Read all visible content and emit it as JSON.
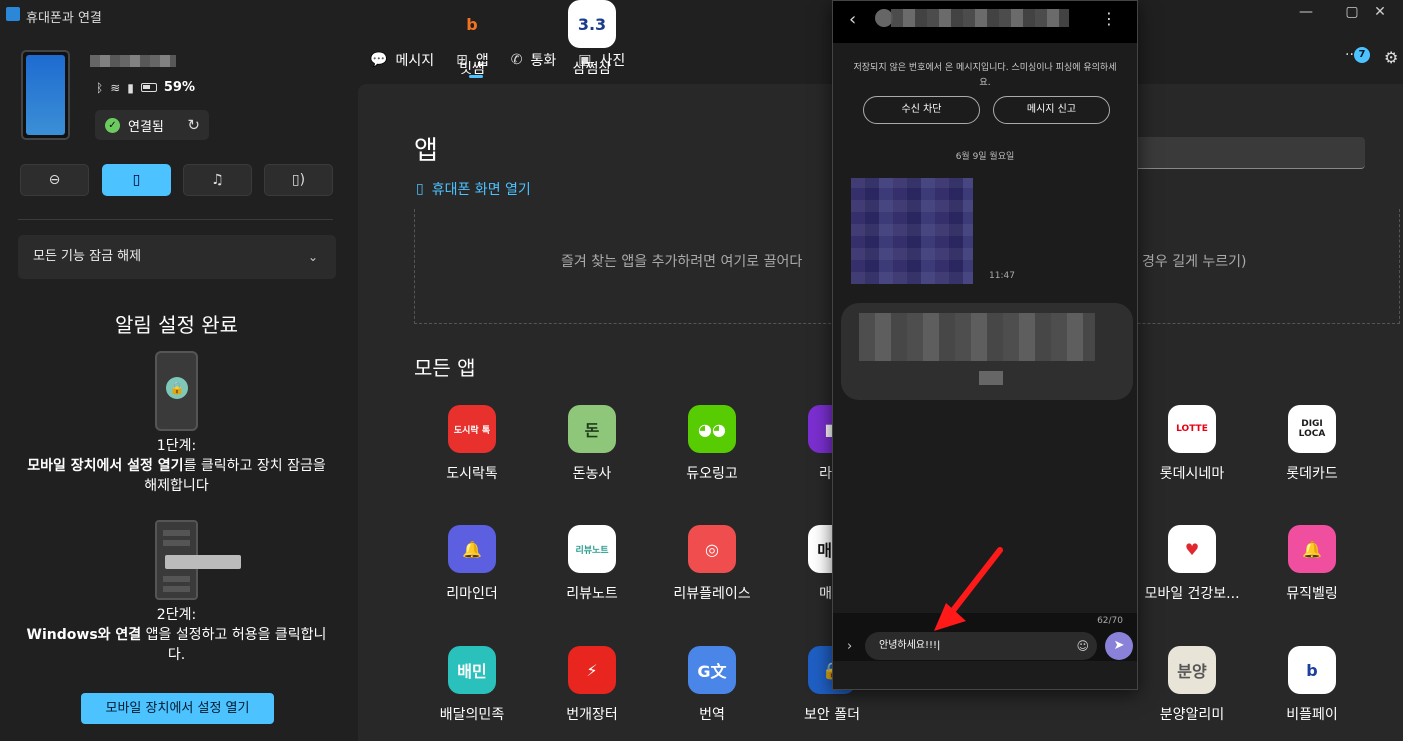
{
  "window": {
    "title": "휴대폰과 연결",
    "controls": [
      "—",
      "▢",
      "✕"
    ]
  },
  "device": {
    "battery": "59%",
    "connection_status": "연결됨"
  },
  "quick_actions": [
    "focus",
    "vibrate",
    "music",
    "audio-output"
  ],
  "unlock_all": "모든 기능 잠금 해제",
  "setup": {
    "title": "알림 설정 완료",
    "step1_heading": "1단계:",
    "step1_text_bold": "모바일 장치에서 설정 열기",
    "step1_text_rest": "를 클릭하고 장치 잠금을 해제합니다",
    "step2_heading": "2단계:",
    "step2_text_bold": "Windows와 연결",
    "step2_text_rest": " 앱을 설정하고 허용을 클릭합니다.",
    "button": "모바일 장치에서 설정 열기"
  },
  "nav": {
    "tabs": [
      {
        "label": "메시지",
        "icon": "chat-icon"
      },
      {
        "label": "앱",
        "icon": "apps-grid-icon",
        "active": true
      },
      {
        "label": "통화",
        "icon": "phone-icon"
      },
      {
        "label": "사진",
        "icon": "photo-icon"
      }
    ],
    "notification_count": "7"
  },
  "apps_page": {
    "title": "앱",
    "open_phone_screen": "휴대폰 화면 열기",
    "favorites_hint_left": "즐겨 찾는 앱을 추가하려면 여기로 끌어다",
    "favorites_hint_right": "경우 길게 누르기)",
    "all_apps_title": "모든 앱"
  },
  "apps": [
    {
      "label": "도시락톡",
      "glyph": "도시락\n톡",
      "bg": "#e8302c",
      "fg": "#fff"
    },
    {
      "label": "돈농사",
      "glyph": "돈",
      "bg": "#8fc77a",
      "fg": "#1f3d1a"
    },
    {
      "label": "듀오링고",
      "glyph": "◕◕",
      "bg": "#58cc02",
      "fg": "#fff"
    },
    {
      "label": "라디",
      "glyph": "■",
      "bg": "#7b2fd0",
      "fg": "#fff"
    },
    {
      "label": "롯데시네마",
      "glyph": "LOTTE",
      "bg": "#ffffff",
      "fg": "#e60012"
    },
    {
      "label": "롯데카드",
      "glyph": "DIGI LOCA",
      "bg": "#ffffff",
      "fg": "#1a1a1a"
    },
    {
      "label": "리마인더",
      "glyph": "🔔",
      "bg": "#5b5fe0",
      "fg": "#fff"
    },
    {
      "label": "리뷰노트",
      "glyph": "리뷰노트",
      "bg": "#ffffff",
      "fg": "#2a9d8f"
    },
    {
      "label": "리뷰플레이스",
      "glyph": "◎",
      "bg": "#f04e4e",
      "fg": "#fff"
    },
    {
      "label": "매일",
      "glyph": "매일",
      "bg": "#ffffff",
      "fg": "#111"
    },
    {
      "label": "모바일 건강보...",
      "glyph": "♥",
      "bg": "#ffffff",
      "fg": "#e0282e"
    },
    {
      "label": "뮤직벨링",
      "glyph": "🔔",
      "bg": "#f04fa0",
      "fg": "#fff"
    },
    {
      "label": "배달의민족",
      "glyph": "배민",
      "bg": "#2ac1bc",
      "fg": "#fff"
    },
    {
      "label": "번개장터",
      "glyph": "⚡",
      "bg": "#e8251f",
      "fg": "#fff"
    },
    {
      "label": "번역",
      "glyph": "G文",
      "bg": "#4a86e8",
      "fg": "#fff"
    },
    {
      "label": "보안 폴더",
      "glyph": "🔒",
      "bg": "#1f5fc4",
      "fg": "#fff"
    },
    {
      "label": "분양알리미",
      "glyph": "분양",
      "bg": "#e9e4d8",
      "fg": "#555"
    },
    {
      "label": "비플페이",
      "glyph": "b",
      "bg": "#ffffff",
      "fg": "#1d3f9e"
    },
    {
      "label": "빗썸",
      "glyph": "b",
      "bg": "#202020",
      "fg": "#f37321"
    },
    {
      "label": "삼쩜삼",
      "glyph": "3.3",
      "bg": "#ffffff",
      "fg": "#1b3c8c"
    }
  ],
  "phone_window": {
    "warning": "저장되지 않은 번호에서 온 메시지입니다. 스미싱이나 피싱에 유의하세요.",
    "block_button": "수신 차단",
    "report_button": "메시지 신고",
    "date": "6월 9일 월요일",
    "time": "11:47",
    "char_counter": "62/70",
    "input_value": "안녕하세요!!!|"
  }
}
